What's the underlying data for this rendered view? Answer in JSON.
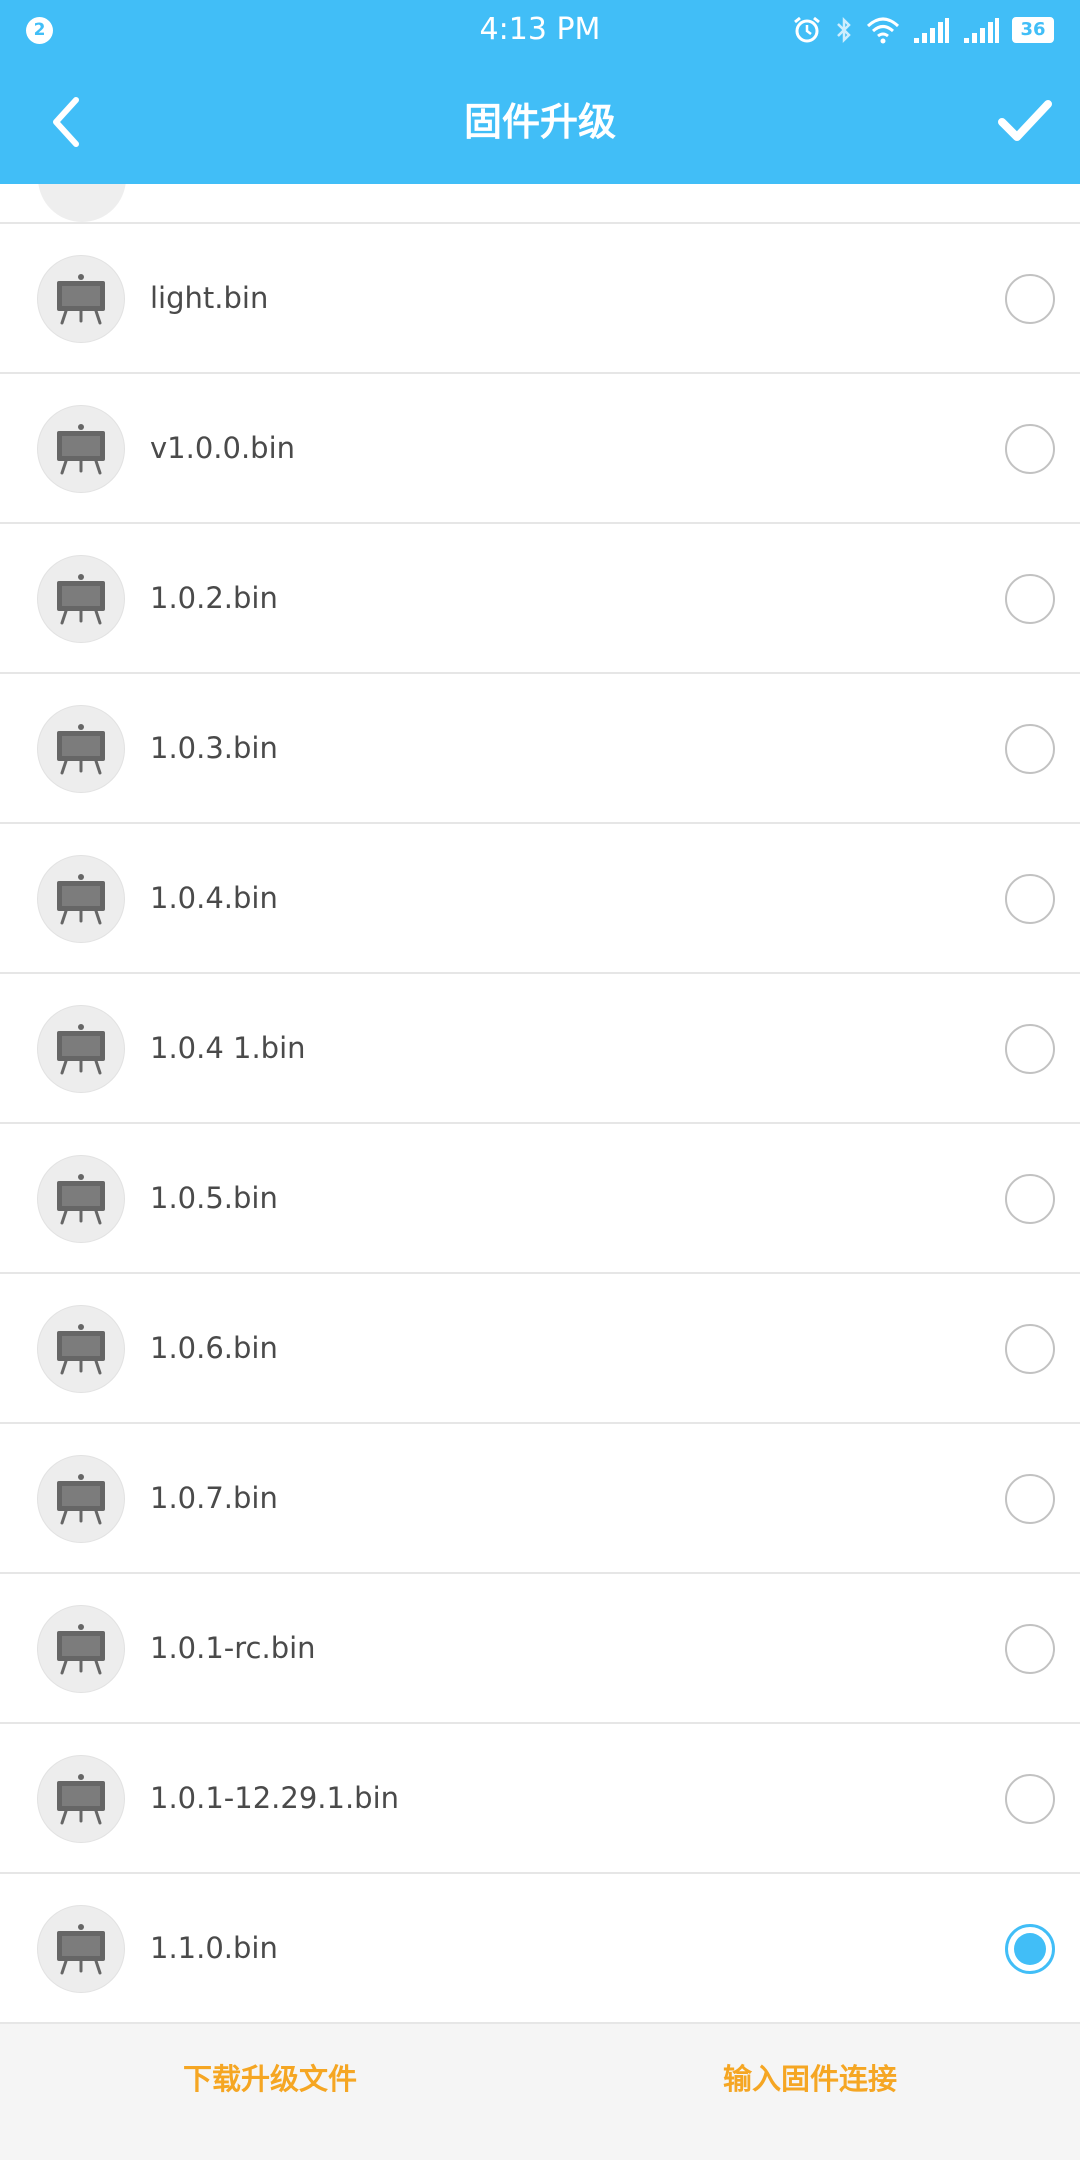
{
  "status_bar": {
    "notification_count": "2",
    "time": "4:13 PM",
    "battery": "36",
    "icons": [
      "alarm-icon",
      "bluetooth-icon",
      "wifi-icon",
      "signal-icon",
      "signal-2-icon",
      "battery-icon"
    ]
  },
  "app_bar": {
    "title": "固件升级",
    "back_icon": "back-arrow-icon",
    "confirm_icon": "check-icon"
  },
  "firmware_list": {
    "item_icon": "easel-board-icon",
    "items": [
      {
        "name": "light.bin",
        "selected": false
      },
      {
        "name": "v1.0.0.bin",
        "selected": false
      },
      {
        "name": "1.0.2.bin",
        "selected": false
      },
      {
        "name": "1.0.3.bin",
        "selected": false
      },
      {
        "name": "1.0.4.bin",
        "selected": false
      },
      {
        "name": "1.0.4 1.bin",
        "selected": false
      },
      {
        "name": "1.0.5.bin",
        "selected": false
      },
      {
        "name": "1.0.6.bin",
        "selected": false
      },
      {
        "name": "1.0.7.bin",
        "selected": false
      },
      {
        "name": "1.0.1-rc.bin",
        "selected": false
      },
      {
        "name": "1.0.1-12.29.1.bin",
        "selected": false
      },
      {
        "name": "1.1.0.bin",
        "selected": true
      }
    ]
  },
  "bottom_bar": {
    "download_label": "下载升级文件",
    "input_link_label": "输入固件连接"
  },
  "colors": {
    "primary": "#41bef7",
    "accent": "#f5a623",
    "text": "#4a4a4a",
    "divider": "#e6e6e6"
  }
}
